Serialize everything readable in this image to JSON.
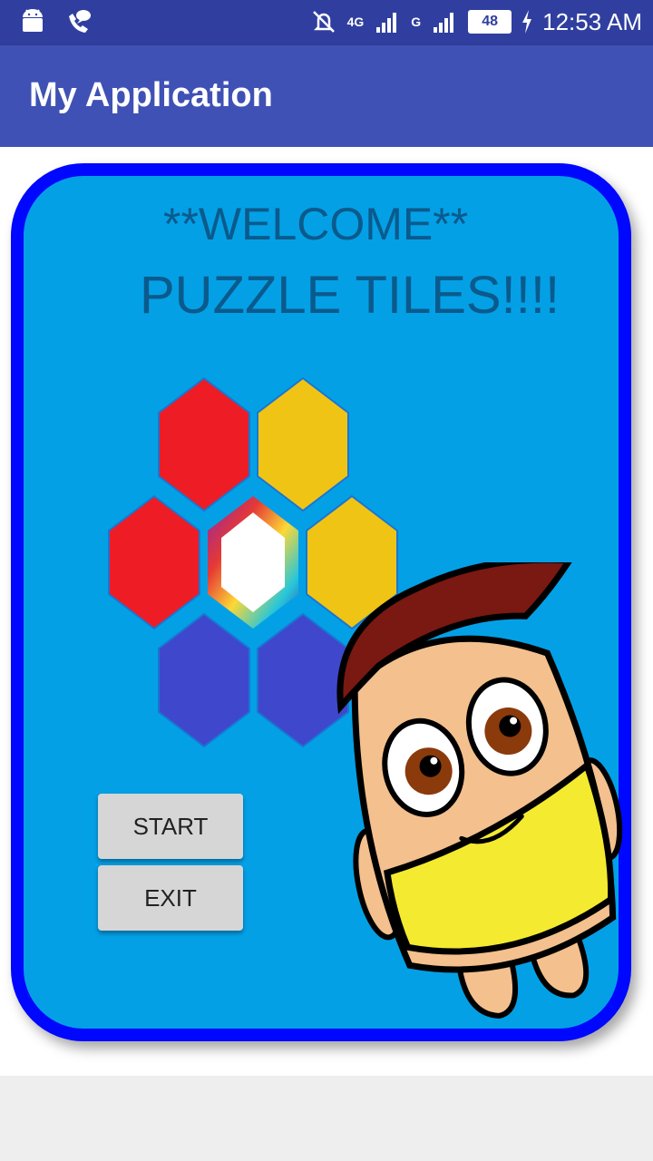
{
  "status_bar": {
    "time": "12:53 AM",
    "battery_level": "48",
    "network_labels": [
      "4G",
      "G"
    ]
  },
  "app_bar": {
    "title": "My Application"
  },
  "main": {
    "welcome_text": "**WELCOME**",
    "game_title": "PUZZLE TILES!!!!",
    "buttons": {
      "start": "START",
      "exit": "EXIT"
    }
  },
  "colors": {
    "status_bar": "#303f9f",
    "app_bar": "#3f51b5",
    "panel_bg": "#04a0e6",
    "panel_border": "#0007ff",
    "hex_red": "#ee1c25",
    "hex_yellow": "#f0c415",
    "hex_blue": "#3f47cc"
  },
  "icons": [
    "android-icon",
    "phone-chat-icon",
    "mute-bell-icon",
    "signal-icon",
    "battery-icon",
    "charging-icon"
  ]
}
